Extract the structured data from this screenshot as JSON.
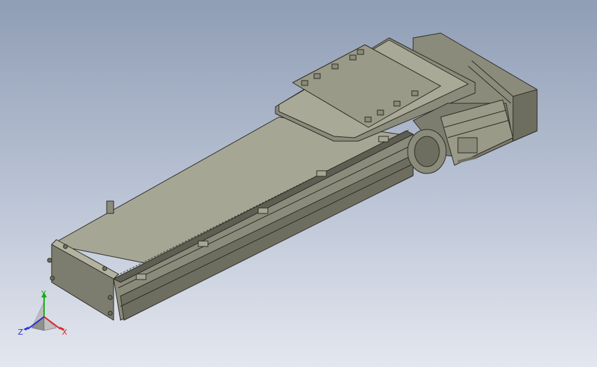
{
  "viewport": {
    "background_top": "#8f9db5",
    "background_bottom": "#e4e7ef"
  },
  "model": {
    "body_color": "#8b8b7c",
    "top_color": "#a6a694",
    "shade_color": "#6e6e60",
    "edge_color": "#2b2b24"
  },
  "triad": {
    "x_label": "X",
    "y_label": "Y",
    "z_label": "Z",
    "x_color": "#e02020",
    "y_color": "#10b010",
    "z_color": "#2030d0"
  }
}
